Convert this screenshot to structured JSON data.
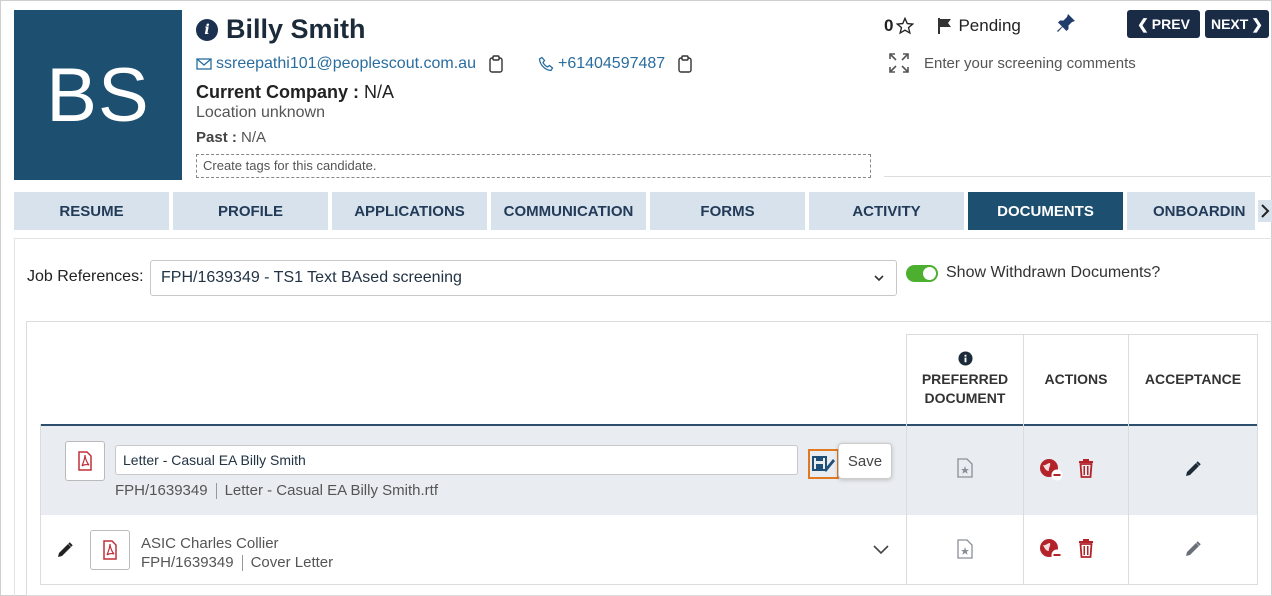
{
  "candidate": {
    "initials": "BS",
    "name": "Billy Smith",
    "email": "ssreepathi101@peoplescout.com.au",
    "phone": "+61404597487",
    "company_label": "Current Company :",
    "company_value": "N/A",
    "location": "Location unknown",
    "past_label": "Past :",
    "past_value": "N/A",
    "tags_placeholder": "Create tags for this candidate."
  },
  "header_right": {
    "score": "0",
    "status": "Pending",
    "prev_label": "PREV",
    "next_label": "NEXT",
    "comments_placeholder": "Enter your screening comments"
  },
  "tabs": [
    {
      "label": "RESUME"
    },
    {
      "label": "PROFILE"
    },
    {
      "label": "APPLICATIONS"
    },
    {
      "label": "COMMUNICATION"
    },
    {
      "label": "FORMS"
    },
    {
      "label": "ACTIVITY"
    },
    {
      "label": "DOCUMENTS"
    },
    {
      "label": "ONBOARDIN"
    }
  ],
  "documents": {
    "job_ref_label": "Job References:",
    "job_ref_value": "FPH/1639349 - TS1 Text BAsed screening",
    "toggle_label": "Show Withdrawn Documents?",
    "columns": {
      "preferred_line1": "PREFERRED",
      "preferred_line2": "DOCUMENT",
      "actions": "ACTIONS",
      "acceptance": "ACCEPTANCE"
    },
    "rows": [
      {
        "edit_value": "Letter - Casual EA Billy Smith",
        "ref": "FPH/1639349",
        "file": "Letter - Casual EA Billy Smith.rtf",
        "save_label": "Save"
      },
      {
        "title": "ASIC Charles Collier",
        "ref": "FPH/1639349",
        "type": "Cover Letter"
      }
    ]
  },
  "colors": {
    "primary": "#1d4f70",
    "nav_dark": "#1a2b45",
    "tab_bg": "#d8e2ec",
    "accent_red": "#b4232a",
    "toggle_green": "#4caf2f",
    "highlight_orange": "#e07a22"
  }
}
